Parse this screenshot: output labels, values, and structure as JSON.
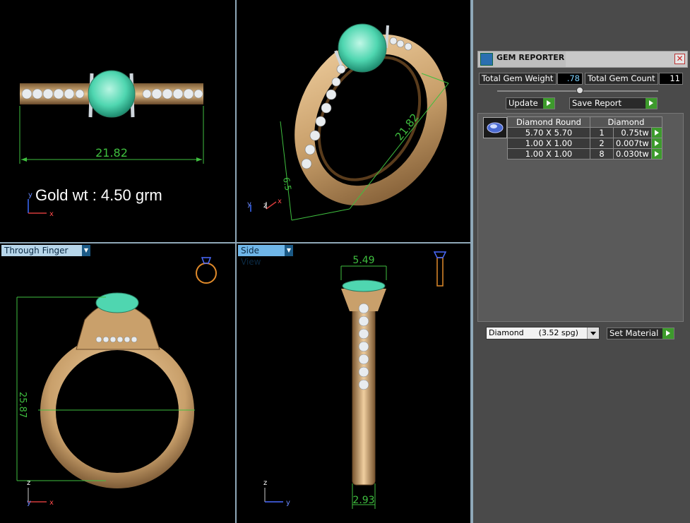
{
  "viewports": {
    "top": {
      "dimension": "21.82",
      "gold_weight": "Gold wt : 4.50 grm",
      "axes": [
        "y",
        "x"
      ]
    },
    "perspective": {
      "dimension_length": "21.82",
      "dimension_height": "6.5",
      "axes": [
        "y",
        "z",
        "x"
      ]
    },
    "front": {
      "tab_label": "Through Finger",
      "dimension_height": "25.87",
      "axes": [
        "z",
        "y",
        "x"
      ]
    },
    "side": {
      "tab_label": "Side View",
      "dimension_top": "5.49",
      "dimension_bottom": "2.93",
      "axes": [
        "z",
        "y"
      ]
    }
  },
  "gem_reporter": {
    "title": "GEM REPORTER",
    "total_weight_label": "Total Gem Weight",
    "total_weight_value": ".78",
    "total_count_label": "Total Gem Count",
    "total_count_value": "11",
    "update_label": "Update",
    "save_report_label": "Save Report",
    "table": {
      "headers": [
        "Diamond Round",
        "Diamond"
      ],
      "rows": [
        {
          "size": "5.70 X 5.70",
          "count": "1",
          "weight": "0.75tw"
        },
        {
          "size": "1.00 X 1.00",
          "count": "2",
          "weight": "0.007tw"
        },
        {
          "size": "1.00 X 1.00",
          "count": "8",
          "weight": "0.030tw"
        }
      ]
    },
    "material_value": "Diamond      (3.52 spg)",
    "set_material_label": "Set Material"
  },
  "colors": {
    "gold": "#c9a06b",
    "emerald": "#4fd6b0",
    "dimension": "#3fbf3f",
    "panel": "#4a4a4a"
  }
}
